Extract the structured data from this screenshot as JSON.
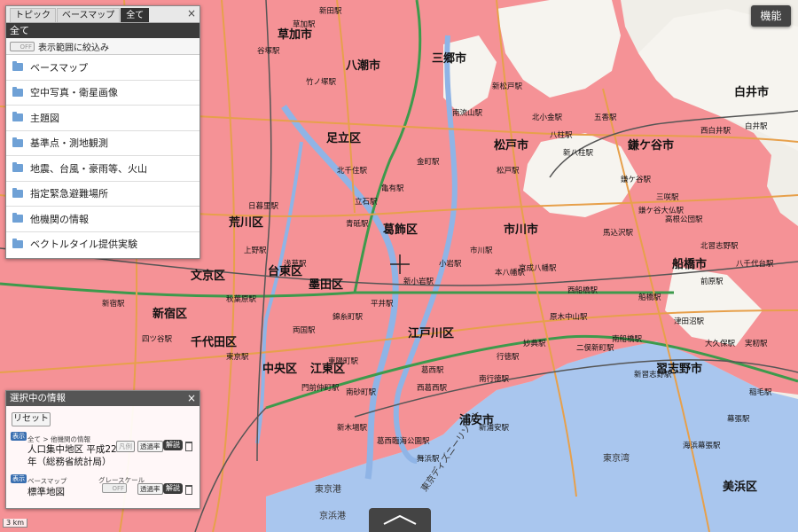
{
  "function_button": "機能",
  "layer_panel": {
    "tabs": [
      "トピック",
      "ベースマップ",
      "全て"
    ],
    "close": "×",
    "heading": "全て",
    "filter_toggle": "OFF",
    "filter_label": "表示範囲に絞込み",
    "items": [
      "ベースマップ",
      "空中写真・衛星画像",
      "主題図",
      "基準点・測地観測",
      "地震、台風・豪雨等、火山",
      "指定緊急避難場所",
      "他機関の情報",
      "ベクトルタイル提供実験"
    ]
  },
  "info_panel": {
    "title": "選択中の情報",
    "close": "×",
    "reset": "リセット",
    "layer1": {
      "badge": "表示",
      "path": "全て > 他機関の情報",
      "name_line1": "人口集中地区 平成22",
      "name_line2": "年（総務省統計局）",
      "btn1": "凡例",
      "btn2": "透過率",
      "desc": "解説"
    },
    "layer2": {
      "badge": "表示",
      "path": "ベースマップ",
      "name": "標準地図",
      "grayscale_label": "グレースケール",
      "toggle": "OFF",
      "btn2": "透過率",
      "desc": "解説"
    }
  },
  "scale": "3 km",
  "map": {
    "wards": [
      "草加市",
      "八潮市",
      "足立区",
      "荒川区",
      "葛飾区",
      "市川市",
      "松戸市",
      "白井市",
      "船橋市",
      "鎌ケ谷市",
      "文京区",
      "台東区",
      "墨田区",
      "新宿区",
      "千代田区",
      "中央区",
      "江東区",
      "江戸川区",
      "浦安市",
      "習志野市",
      "美浜区",
      "三郷市"
    ],
    "stations": [
      "草加駅",
      "新田駅",
      "谷塚駅",
      "竹ノ塚駅",
      "北千住駅",
      "亀有駅",
      "金町駅",
      "新小岩駅",
      "平井駅",
      "錦糸町駅",
      "両国駅",
      "上野駅",
      "日暮里駅",
      "浅草駅",
      "秋葉原駅",
      "東京駅",
      "新宿駅",
      "四ツ谷駅",
      "本八幡駅",
      "西船橋駅",
      "船橋駅",
      "市川駅",
      "松戸駅",
      "新松戸駅",
      "南流山駅",
      "北小金駅",
      "八柱駅",
      "新八柱駅",
      "五香駅",
      "鎌ケ谷駅",
      "北習志野駅",
      "津田沼駅",
      "幕張駅",
      "海浜幕張駅",
      "新浦安駅",
      "舞浜駅",
      "葛西臨海公園駅",
      "西葛西駅",
      "葛西駅",
      "南砂町駅",
      "門前仲町駅",
      "新木場駅",
      "東陽町駅",
      "京成八幡駅",
      "青砥駅",
      "立石駅",
      "小岩駅",
      "行徳駅",
      "南行徳駅",
      "妙典駅",
      "原木中山駅",
      "二俣新町駅",
      "南船橋駅",
      "新習志野駅",
      "稲毛駅",
      "西白井駅",
      "白井駅",
      "鎌ケ谷大仏駅",
      "馬込沢駅",
      "三咲駅",
      "高根公団駅",
      "前原駅",
      "大久保駅",
      "実籾駅",
      "八千代台駅"
    ],
    "water_labels": [
      "東京湾",
      "東京港",
      "京浜港",
      "東京ディズニーリゾート"
    ]
  }
}
